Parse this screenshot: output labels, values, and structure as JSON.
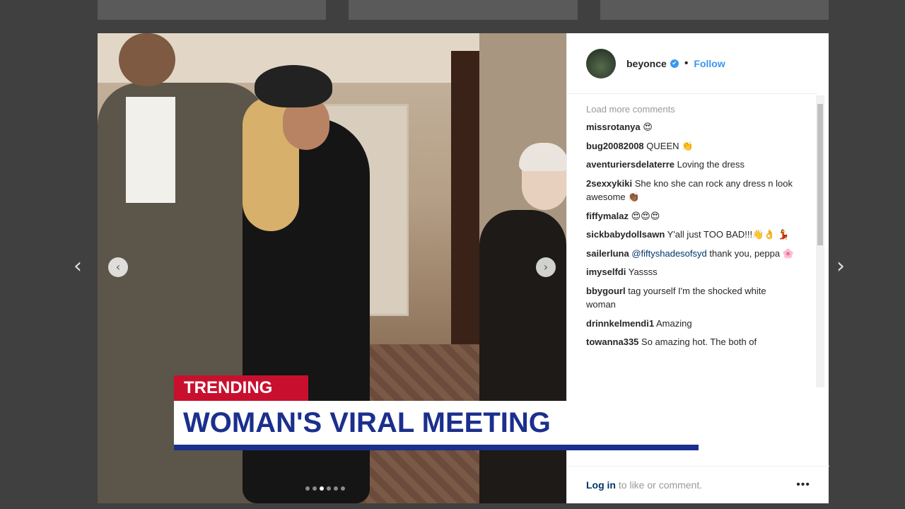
{
  "post": {
    "username": "beyonce",
    "verified_badge": "✔",
    "separator": "•",
    "follow_label": "Follow",
    "load_more": "Load more comments",
    "comments": [
      {
        "user": "missrotanya",
        "text": "😍"
      },
      {
        "user": "bug20082008",
        "text": "QUEEN 👏"
      },
      {
        "user": "aventuriersdelaterre",
        "text": "Loving the dress"
      },
      {
        "user": "2sexxykiki",
        "text": "She kno she can rock any dress n look awesome 👏🏾"
      },
      {
        "user": "fiffymalaz",
        "text": "😍😍😍"
      },
      {
        "user": "sickbabydollsawn",
        "text": "Y'all just TOO BAD!!!👋👌 💃"
      },
      {
        "user": "sailerluna",
        "mention": "@fiftyshadesofsyd",
        "text": " thank you, peppa 🌸"
      },
      {
        "user": "imyselfdi",
        "text": "Yassss"
      },
      {
        "user": "bbygourl",
        "text": "tag yourself I'm the shocked white woman"
      },
      {
        "user": "drinnkelmendi1",
        "text": "Amazing"
      },
      {
        "user": "towanna335",
        "text": "So amazing hot. The both of"
      }
    ],
    "login_link": "Log in",
    "login_rest": " to like or comment.",
    "more_icon": "•••"
  },
  "overlay": {
    "tag": "TRENDING",
    "headline": "WOMAN'S VIRAL MEETING"
  },
  "nav": {
    "prev": "‹",
    "next": "›"
  },
  "carousel": {
    "prev": "‹",
    "next": "›",
    "dot_count": 6,
    "active_dot": 2
  },
  "colors": {
    "accent_blue": "#3897f0",
    "news_red": "#c8102e",
    "news_blue": "#1b2f8c"
  }
}
